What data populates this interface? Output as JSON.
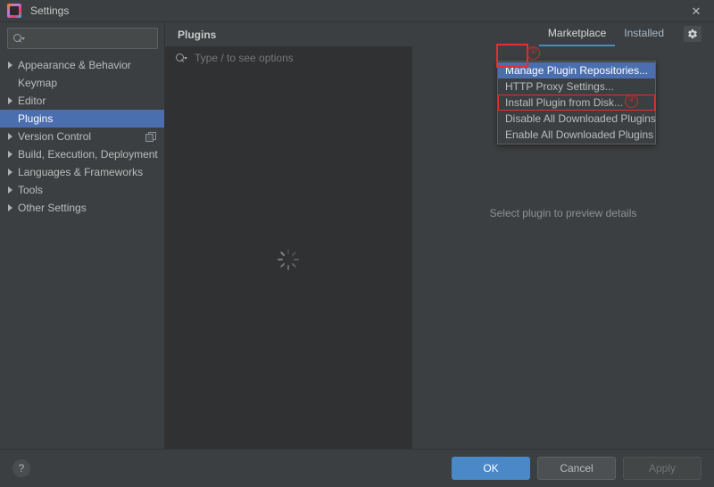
{
  "window": {
    "title": "Settings",
    "app_icon": "intellij-idea-icon",
    "close_label": "✕"
  },
  "sidebar": {
    "search": {
      "value": "",
      "placeholder": "",
      "icon": "search-icon"
    },
    "items": [
      {
        "label": "Appearance & Behavior",
        "expandable": true,
        "selected": false,
        "trailing_icon": ""
      },
      {
        "label": "Keymap",
        "expandable": false,
        "selected": false,
        "trailing_icon": ""
      },
      {
        "label": "Editor",
        "expandable": true,
        "selected": false,
        "trailing_icon": ""
      },
      {
        "label": "Plugins",
        "expandable": false,
        "selected": true,
        "trailing_icon": ""
      },
      {
        "label": "Version Control",
        "expandable": true,
        "selected": false,
        "trailing_icon": "copy-icon"
      },
      {
        "label": "Build, Execution, Deployment",
        "expandable": true,
        "selected": false,
        "trailing_icon": ""
      },
      {
        "label": "Languages & Frameworks",
        "expandable": true,
        "selected": false,
        "trailing_icon": ""
      },
      {
        "label": "Tools",
        "expandable": true,
        "selected": false,
        "trailing_icon": ""
      },
      {
        "label": "Other Settings",
        "expandable": true,
        "selected": false,
        "trailing_icon": ""
      }
    ]
  },
  "main": {
    "title": "Plugins",
    "tabs": [
      {
        "label": "Marketplace",
        "active": true
      },
      {
        "label": "Installed",
        "active": false
      }
    ],
    "gear_icon": "gear-icon",
    "plugin_search": {
      "placeholder": "Type / to see options",
      "value": "",
      "icon": "search-icon"
    },
    "loading_indicator": "loading-spinner",
    "preview_hint": "Select plugin to preview details"
  },
  "menu": {
    "items": [
      {
        "label": "Manage Plugin Repositories...",
        "highlighted": true,
        "outlined": false
      },
      {
        "label": "HTTP Proxy Settings...",
        "highlighted": false,
        "outlined": false
      },
      {
        "label": "Install Plugin from Disk...",
        "highlighted": false,
        "outlined": true
      },
      {
        "label": "Disable All Downloaded Plugins",
        "highlighted": false,
        "outlined": false
      },
      {
        "label": "Enable All Downloaded Plugins",
        "highlighted": false,
        "outlined": false
      }
    ]
  },
  "annotations": [
    {
      "marker": "①",
      "target": "gear-button"
    },
    {
      "marker": "②",
      "target": "install-plugin-from-disk-menu-item"
    }
  ],
  "footer": {
    "help_label": "?",
    "buttons": [
      {
        "label": "OK",
        "style": "primary",
        "disabled": false
      },
      {
        "label": "Cancel",
        "style": "default",
        "disabled": false
      },
      {
        "label": "Apply",
        "style": "default",
        "disabled": true
      }
    ]
  },
  "colors": {
    "accent": "#4a88c7",
    "selection": "#4b6eaf",
    "annotation": "#e03030",
    "background": "#3c3f41",
    "panel": "#2f3132"
  }
}
